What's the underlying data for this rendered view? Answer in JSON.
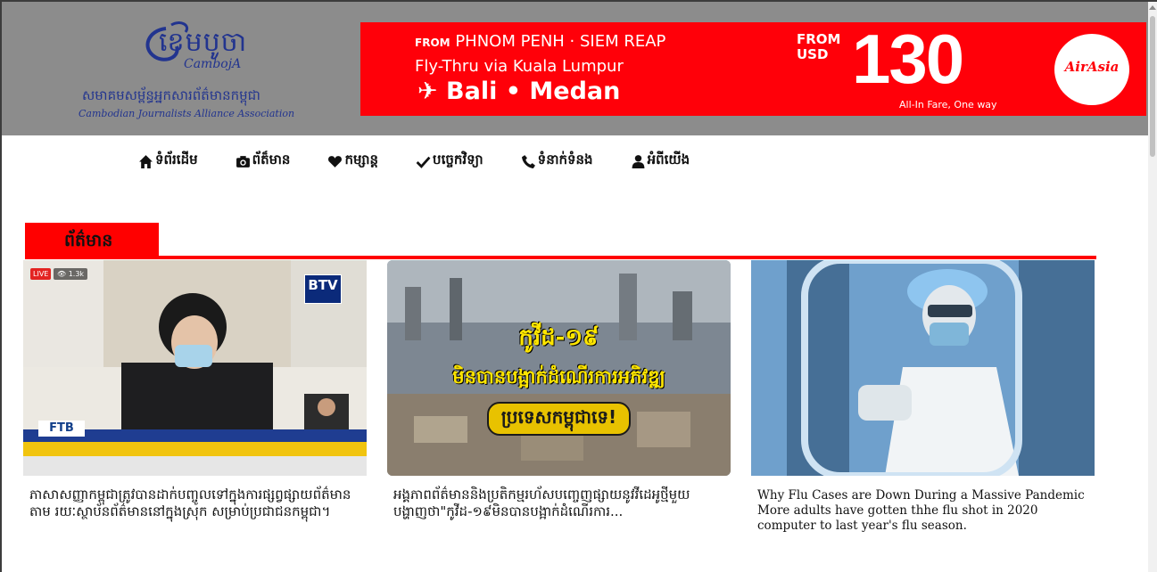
{
  "site": {
    "logo_title": "ខេមបូចា",
    "logo_latin": "CambojA",
    "logo_khmer_name": "សមាគមសម្ព័ន្ធអ្នកសារព័ត៌មានកម្ពុជា",
    "logo_english_name": "Cambodian Journalists Alliance Association",
    "brand_color": "#22348f"
  },
  "banner": {
    "from_label": "FROM",
    "route": "PHNOM PENH · SIEM REAP",
    "via": "Fly-Thru via Kuala Lumpur",
    "destinations": "✈ Bali • Medan",
    "price_prefix_1": "FROM",
    "price_prefix_2": "USD",
    "price": "130",
    "fare_note": "All-In Fare, One way",
    "advertiser": "AirAsia",
    "background_color": "#ff0009"
  },
  "nav": {
    "items": [
      {
        "icon": "home-icon",
        "label": "ទំព័រដើម"
      },
      {
        "icon": "camera-icon",
        "label": "ព័ត៏មាន"
      },
      {
        "icon": "heart-icon",
        "label": "កម្សាន្ត"
      },
      {
        "icon": "check-icon",
        "label": "បច្ចេកវិទ្យា"
      },
      {
        "icon": "phone-icon",
        "label": "ទំនាក់ទំនង"
      },
      {
        "icon": "user-icon",
        "label": "អំពីយើង"
      }
    ]
  },
  "section": {
    "title": "ព័ត៌មាន",
    "accent_color": "#ff0000"
  },
  "articles": [
    {
      "title": "ភាសាសញ្ញាកម្ពុជាត្រូវបានដាក់បញ្ចូលទៅក្នុងការផ្សព្វផ្សាយព័ត៌មាន តាម រយៈស្ថាប័នព័ត៌មាននៅក្នុងស្រុក សម្រាប់ប្រជាជនកម្ពុជា។",
      "image": {
        "live": "LIVE",
        "views": "👁 1.3k",
        "channel": "BTV",
        "sponsor": "FTB"
      }
    },
    {
      "title": "អង្គភាពព័ត៌មាននិងប្រតិកម្មរហ័សបញ្ចេញផ្សាយនូវវីដេអូថ្មីមួយ បង្ហាញថា\"កូវីដ-១៩មិនបានបង្អាក់ដំណើរការ...",
      "image": {
        "line1": "កូវីដ-១៩",
        "line2": "មិនបានបង្អាក់ដំណើរការអភិវឌ្ឍ",
        "line3": "ប្រទេសកម្ពុជាទេ!"
      }
    },
    {
      "title": "Why Flu Cases are Down During a Massive Pandemic More adults have gotten thhe flu shot in 2020 computer to last year's flu season."
    }
  ]
}
